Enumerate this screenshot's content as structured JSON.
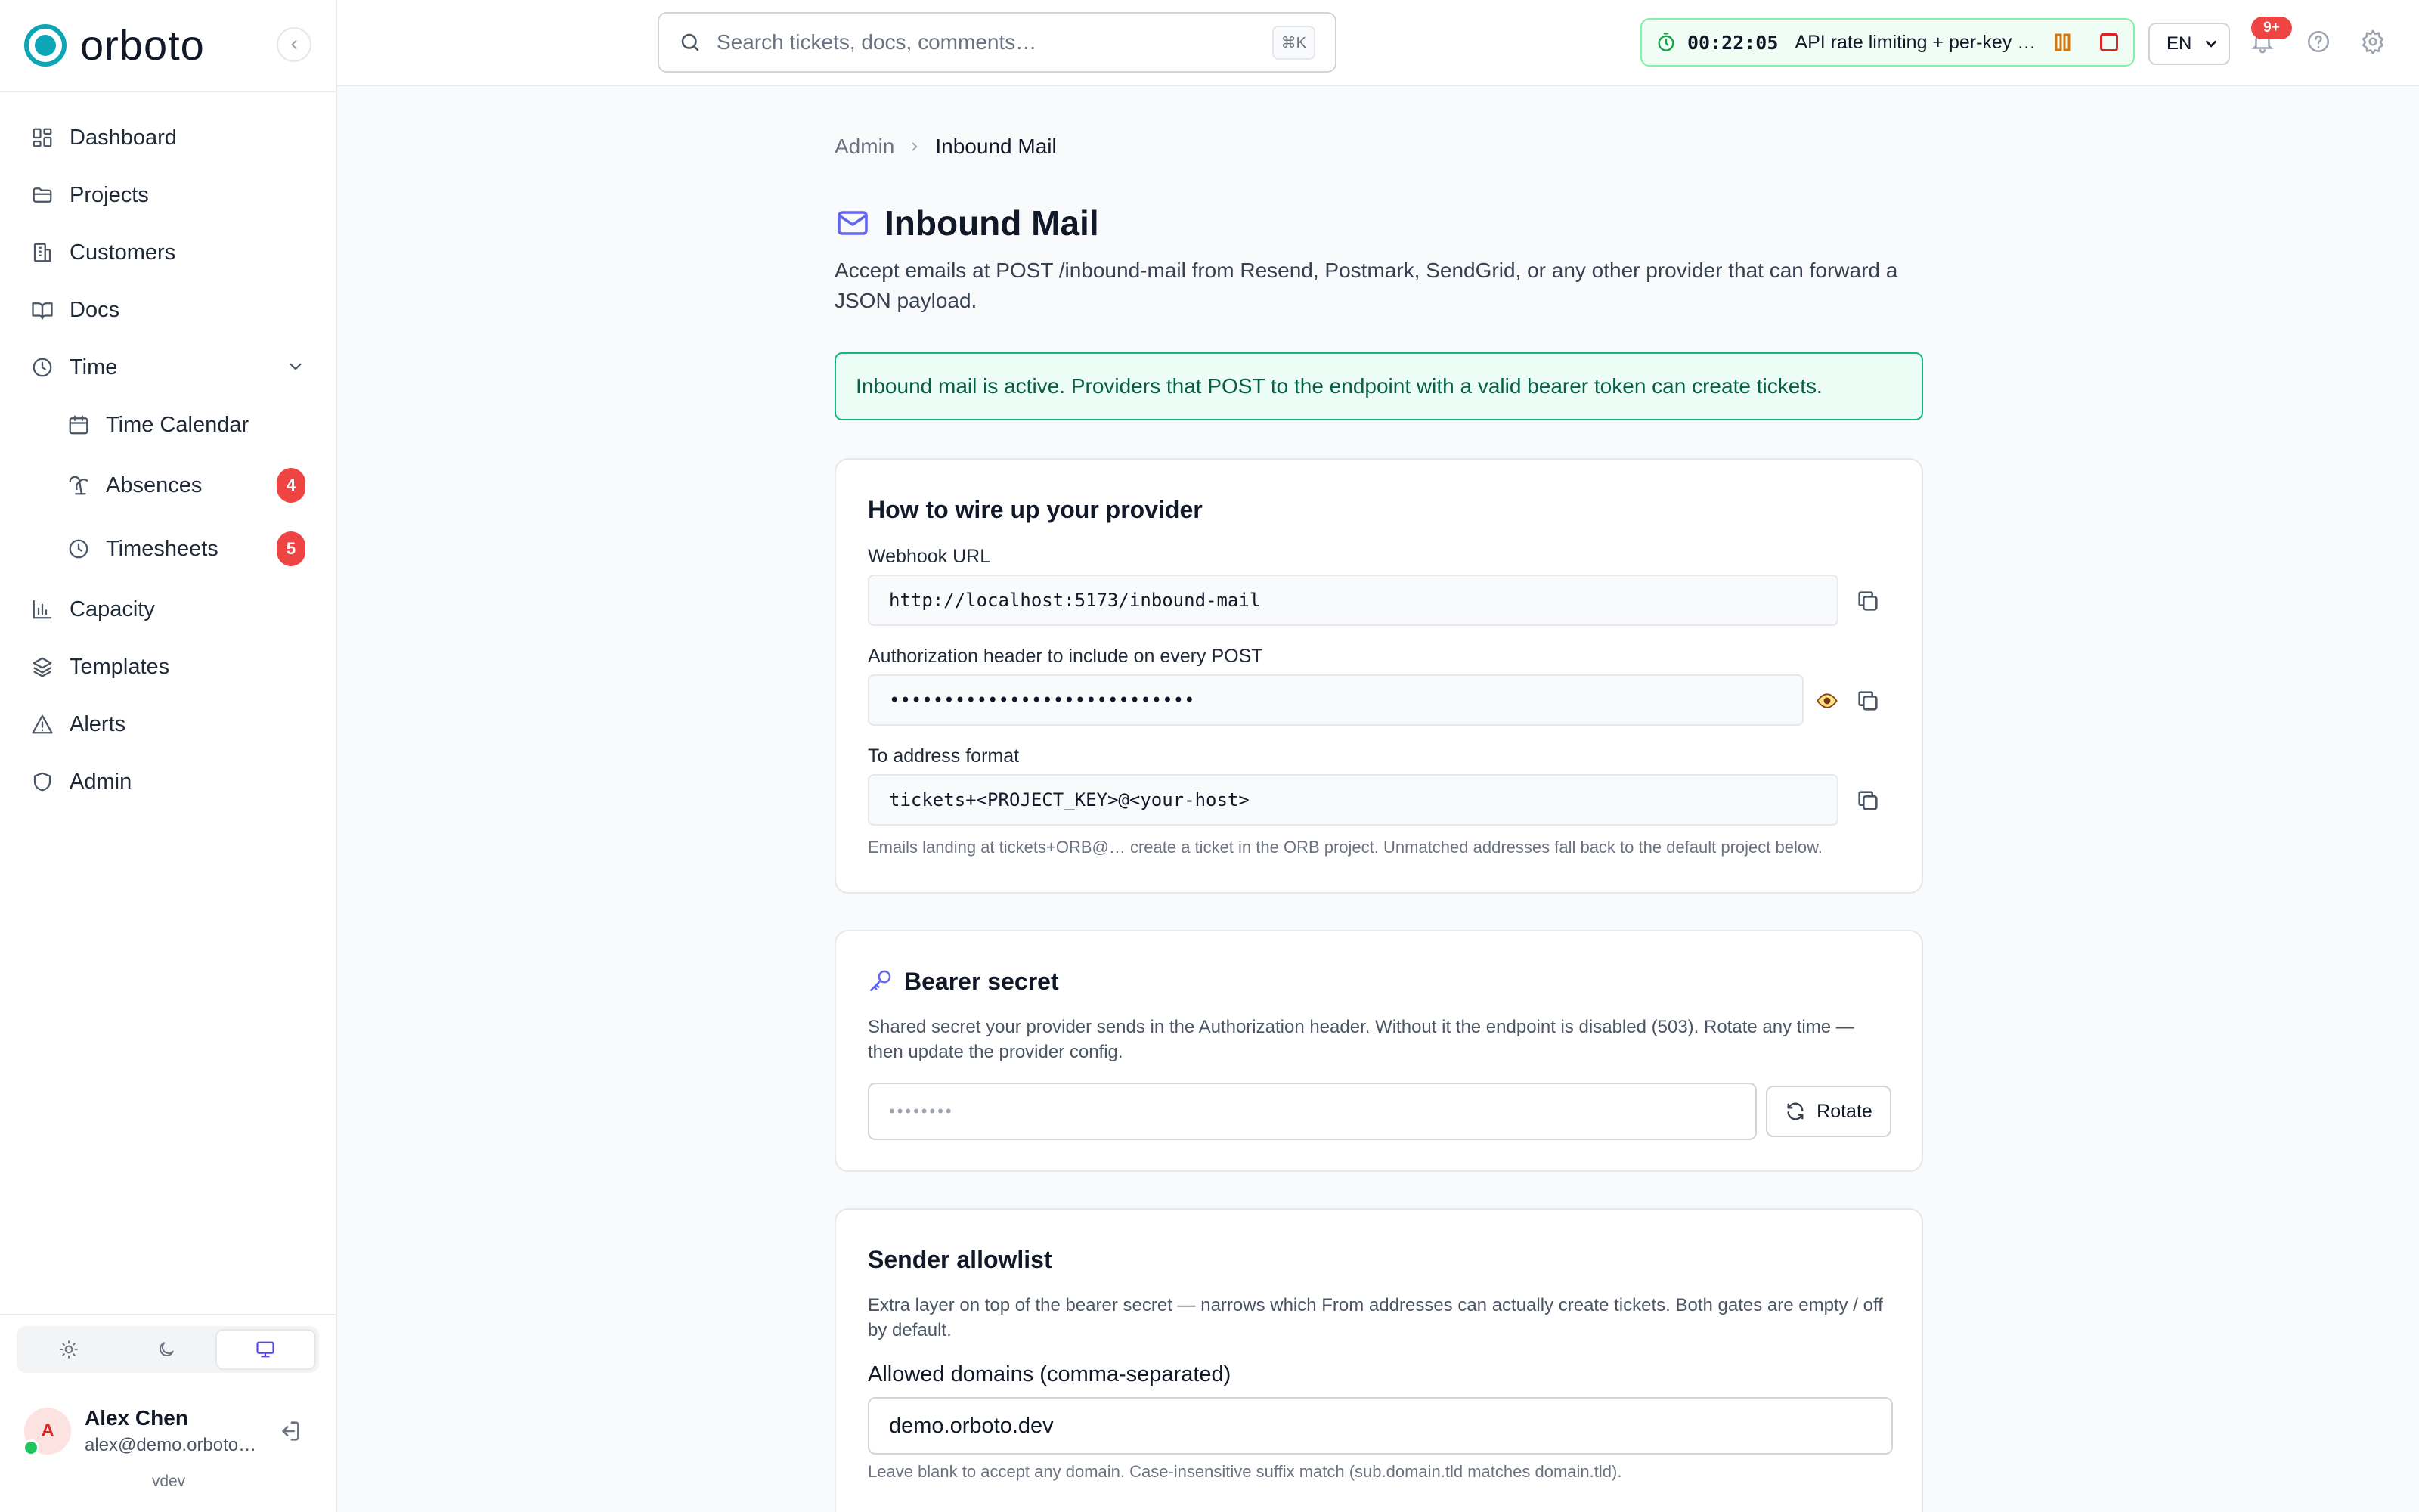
{
  "brand": {
    "name": "orboto"
  },
  "sidebar": {
    "items": [
      {
        "label": "Dashboard"
      },
      {
        "label": "Projects"
      },
      {
        "label": "Customers"
      },
      {
        "label": "Docs"
      },
      {
        "label": "Time"
      },
      {
        "label": "Time Calendar"
      },
      {
        "label": "Absences",
        "badge": "4"
      },
      {
        "label": "Timesheets",
        "badge": "5"
      },
      {
        "label": "Capacity"
      },
      {
        "label": "Templates"
      },
      {
        "label": "Alerts"
      },
      {
        "label": "Admin"
      }
    ],
    "theme_active": "system",
    "user": {
      "initial": "A",
      "name": "Alex Chen",
      "email": "alex@demo.orboto.dev"
    },
    "version": "vdev"
  },
  "topbar": {
    "search_placeholder": "Search tickets, docs, comments…",
    "search_shortcut": "⌘K",
    "timer": {
      "time": "00:22:05",
      "task": "API rate limiting + per-key quotas"
    },
    "language": "EN",
    "notification_badge": "9+"
  },
  "breadcrumb": {
    "parent": "Admin",
    "current": "Inbound Mail"
  },
  "page": {
    "title": "Inbound Mail",
    "description": "Accept emails at POST /inbound-mail from Resend, Postmark, SendGrid, or any other provider that can forward a JSON payload.",
    "status_alert": "Inbound mail is active. Providers that POST to the endpoint with a valid bearer token can create tickets."
  },
  "wire_card": {
    "title": "How to wire up your provider",
    "webhook_label": "Webhook URL",
    "webhook_value": "http://localhost:5173/inbound-mail",
    "auth_label": "Authorization header to include on every POST",
    "auth_value": "••••••••••••••••••••••••••••",
    "to_label": "To address format",
    "to_value": "tickets+<PROJECT_KEY>@<your-host>",
    "to_hint": "Emails landing at tickets+ORB@… create a ticket in the ORB project. Unmatched addresses fall back to the default project below."
  },
  "bearer_card": {
    "title": "Bearer secret",
    "description": "Shared secret your provider sends in the Authorization header. Without it the endpoint is disabled (503). Rotate any time — then update the provider config.",
    "secret_placeholder": "••••••••",
    "rotate_label": "Rotate"
  },
  "allowlist_card": {
    "title": "Sender allowlist",
    "description": "Extra layer on top of the bearer secret — narrows which From addresses can actually create tickets. Both gates are empty / off by default.",
    "domains_label": "Allowed domains (comma-separated)",
    "domains_value": "demo.orboto.dev",
    "domains_hint": "Leave blank to accept any domain. Case-insensitive suffix match (sub.domain.tld matches domain.tld)."
  },
  "colors": {
    "brand": "#0ea5b7",
    "accent": "#6366f1",
    "success_border": "#10b981",
    "badge": "#ef4444"
  }
}
